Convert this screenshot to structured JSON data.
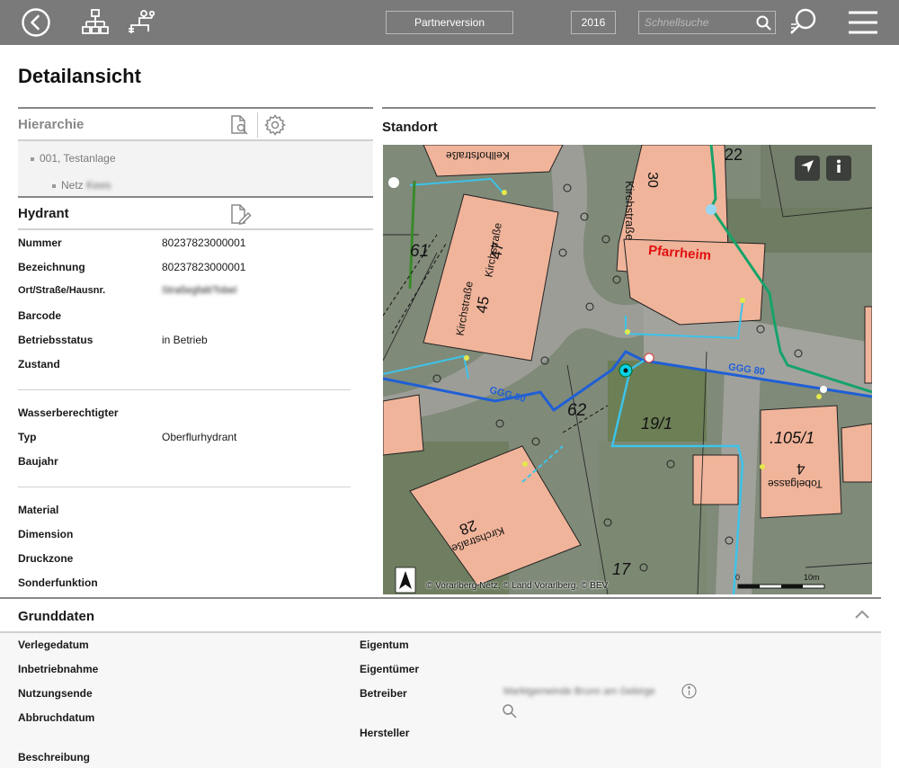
{
  "topbar": {
    "back_icon": "back-circle-icon",
    "hierarchy_icon": "hierarchy-icon",
    "network_icon": "pipe-network-icon",
    "partner_label": "Partnerversion",
    "year_label": "2016",
    "search_placeholder": "Schnellsuche",
    "search_icon": "search-icon",
    "advanced_search_icon": "advanced-search-icon",
    "menu_icon": "hamburger-menu-icon"
  },
  "page_title": "Detailansicht",
  "hierarchy": {
    "title": "Hierarchie",
    "items": [
      {
        "label": "001, Testanlage"
      },
      {
        "label": "Netz",
        "label_blurred": "Kees"
      }
    ]
  },
  "hydrant": {
    "title": "Hydrant",
    "fields_group1": [
      {
        "label": "Nummer",
        "value": "80237823000001"
      },
      {
        "label": "Bezeichnung",
        "value": "80237823000001"
      },
      {
        "label": "Ort/Straße/Hausnr.",
        "value": "Straßegfalt/Tobel"
      },
      {
        "label": "Barcode",
        "value": ""
      },
      {
        "label": "Betriebsstatus",
        "value": "in Betrieb"
      },
      {
        "label": "Zustand",
        "value": ""
      }
    ],
    "fields_group2": [
      {
        "label": "Wasserberechtigter",
        "value": ""
      },
      {
        "label": "Typ",
        "value": "Oberflurhydrant"
      },
      {
        "label": "Baujahr",
        "value": ""
      }
    ],
    "fields_group3": [
      {
        "label": "Material",
        "value": ""
      },
      {
        "label": "Dimension",
        "value": ""
      },
      {
        "label": "Druckzone",
        "value": ""
      },
      {
        "label": "Sonderfunktion",
        "value": ""
      }
    ]
  },
  "standort": {
    "title": "Standort",
    "attribution": "© Vorarlberg Netz, © Land Vorarlberg, © BEV",
    "scale_start": "0",
    "scale_end": "10m",
    "labels": {
      "pfarrheim": "Pfarrheim",
      "n22": "22",
      "n30": "30",
      "kirchstr_top": "Kirchstraße",
      "n61": "61",
      "n47": "47",
      "n45": "45",
      "kirch45": "Kirchstraße",
      "kirch47": "Kirchstraße",
      "n62": "62",
      "n19_1": "19/1",
      "n105_1": ".105/1",
      "n4": "4",
      "tobelgasse": "Tobelgasse",
      "n28": "28",
      "kirch28": "Kirchstraße",
      "n17": "17",
      "ggg80a": "GGG 80",
      "ggg80b": "GGG 80",
      "kellhof": "Kellhofstraße"
    }
  },
  "grunddaten": {
    "title": "Grunddaten",
    "left_labels": [
      "Verlegedatum",
      "Inbetriebnahme",
      "Nutzungsende",
      "Abbruchdatum",
      "Beschreibung"
    ],
    "right_labels": [
      "Eigentum",
      "Eigentümer",
      "Betreiber",
      "Hersteller"
    ],
    "betreiber_value": "Marktgemeinde Brunn am Gebirge"
  },
  "colors": {
    "topbar": "#7a7a7a",
    "map_pipe_blue": "#1f5fd6",
    "map_pipe_cyan": "#3dc3e8",
    "map_pipe_green": "#16a36a",
    "building": "#f0b49a",
    "pfarrheim_red": "#e01010"
  }
}
